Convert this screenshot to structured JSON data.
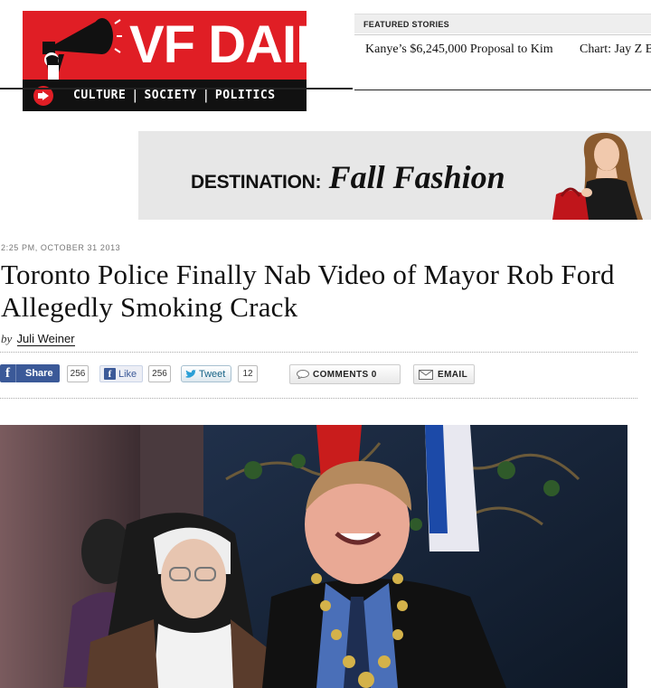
{
  "site": {
    "logo_text": "VF DAILY",
    "nav": [
      "CULTURE",
      "SOCIETY",
      "POLITICS"
    ],
    "brand_red": "#e01e25"
  },
  "featured": {
    "label": "FEATURED STORIES",
    "items": [
      "Kanye’s $6,245,000 Proposal to Kim",
      "Chart: Jay Z Brands"
    ]
  },
  "ad": {
    "prefix": "DESTINATION:",
    "title": "Fall Fashion"
  },
  "article": {
    "timestamp": "2:25 PM, OCTOBER 31 2013",
    "headline": "Toronto Police Finally Nab Video of Mayor Rob Ford Allegedly Smoking Crack",
    "byline_prefix": "by",
    "author": "Juli Weiner"
  },
  "social": {
    "share_label": "Share",
    "share_count": "256",
    "like_label": "Like",
    "like_count": "256",
    "tweet_label": "Tweet",
    "tweet_count": "12",
    "comments_label": "COMMENTS 0",
    "email_label": "EMAIL",
    "facebook_color": "#3b5998"
  }
}
